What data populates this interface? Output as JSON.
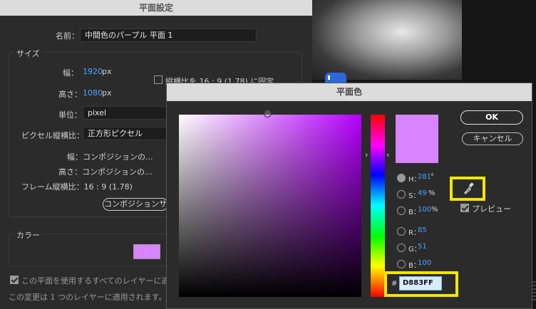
{
  "solid_settings": {
    "title": "平面設定",
    "name_label": "名前：",
    "name_value": "中間色のパープル 平面 1",
    "size_section": "サイズ",
    "width_label": "幅：",
    "width_value": "1920",
    "width_unit": "px",
    "height_label": "高さ：",
    "height_value": "1080",
    "height_unit": "px",
    "lock_aspect_label": "縦横比を 16 : 9 (1.78) に固定",
    "units_label": "単位：",
    "units_value": "pixel",
    "pixel_aspect_label": "ピクセル縦横比：",
    "pixel_aspect_value": "正方形ピクセル",
    "comp_width": "幅：コンポジションの...",
    "comp_height": "高さ：コンポジションの...",
    "frame_aspect": "フレーム縦横比：16 : 9 (1.78)",
    "make_comp_size_button": "コンポジションサ",
    "color_section": "カラー",
    "color_swatch": "#D883FF",
    "affect_all_label": "この平面を使用するすべてのレイヤーに適",
    "note": "この変更は 1 つのレイヤーに適用されます。"
  },
  "color_picker": {
    "title": "平面色",
    "ok_label": "OK",
    "cancel_label": "キャンセル",
    "preview_label": "プレビュー",
    "current_color": "#D883FF",
    "hsb": {
      "h_label": "H：",
      "h_value": "281",
      "h_unit": "°",
      "s_label": "S：",
      "s_value": "49",
      "s_unit": "%",
      "b_label": "B：",
      "b_value": "100",
      "b_unit": "%"
    },
    "rgb": {
      "r_label": "R：",
      "r_value": "85",
      "g_label": "G：",
      "g_value": "51",
      "b_label": "B：",
      "b_value": "100"
    },
    "hex_prefix": "#",
    "hex_value": "D883FF",
    "highlight_color": "#f2e600"
  }
}
